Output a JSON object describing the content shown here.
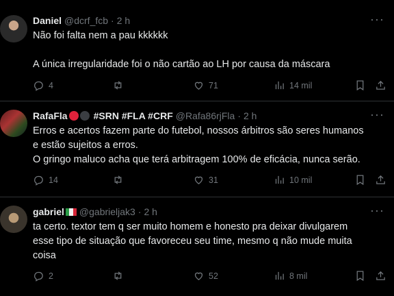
{
  "tweets": [
    {
      "name": "Daniel",
      "handle": "@dcrf_fcb",
      "separator": "·",
      "time": "2 h",
      "lines": [
        "Não foi falta nem a pau kkkkkk",
        "",
        "A única irregularidade foi o não cartão ao LH por causa da máscara"
      ],
      "reply_count": "4",
      "retweet_count": "",
      "like_count": "71",
      "views": "14 mil"
    },
    {
      "name": "RafaFla",
      "tags": "#SRN #FLA #CRF",
      "handle": "@Rafa86rjFla",
      "separator": "·",
      "time": "2 h",
      "lines": [
        "Erros e acertos fazem parte do futebol, nossos árbitros são seres humanos",
        "e estão sujeitos a erros.",
        "O gringo maluco acha que terá arbitragem 100% de eficácia, nunca serão."
      ],
      "reply_count": "14",
      "retweet_count": "",
      "like_count": "31",
      "views": "10 mil"
    },
    {
      "name": "gabriel",
      "handle": "@gabrieljak3",
      "separator": "·",
      "time": "2 h",
      "lines": [
        "ta certo. textor tem q ser muito homem e honesto pra deixar divulgarem",
        "esse tipo de situação que favoreceu seu time, mesmo q não mude muita",
        "coisa"
      ],
      "reply_count": "2",
      "retweet_count": "",
      "like_count": "52",
      "views": "8 mil"
    }
  ],
  "more_label": "···",
  "colors": {
    "background": "#000000",
    "text": "#e7e9ea",
    "muted": "#71767b",
    "divider": "#2f3336"
  },
  "icons": [
    "reply-icon",
    "retweet-icon",
    "like-icon",
    "views-icon",
    "bookmark-icon",
    "share-icon",
    "more-icon"
  ]
}
